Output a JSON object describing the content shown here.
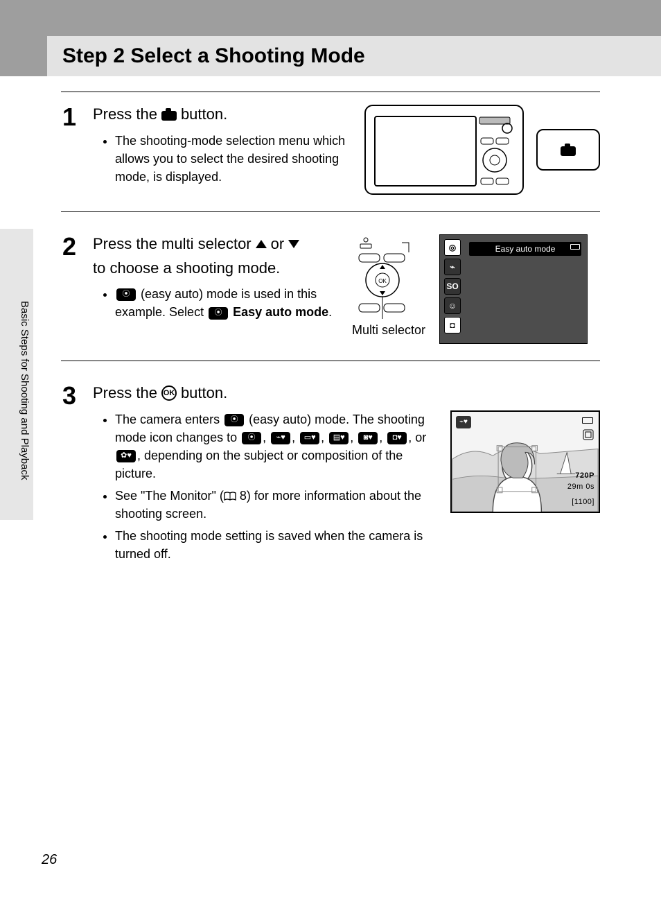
{
  "title": "Step 2 Select a Shooting Mode",
  "side_label": "Basic Steps for Shooting and Playback",
  "page_number": "26",
  "steps": {
    "s1": {
      "num": "1",
      "head_a": "Press the",
      "head_b": "button.",
      "bullet1": "The shooting-mode selection menu which allows you to select the desired shooting mode, is displayed."
    },
    "s2": {
      "num": "2",
      "head_a": "Press the multi selector",
      "head_b": "or",
      "head_c": "to choose a shooting mode.",
      "bullet1_a": "(easy auto) mode is used in this example. Select",
      "bullet1_b": "Easy auto mode",
      "bullet1_c": ".",
      "label_multi": "Multi selector",
      "menu_label": "Easy auto mode",
      "menu_icons": {
        "i1": "◎",
        "i2": "⌁",
        "i3": "SO",
        "i4": "☺",
        "i5": "◘"
      }
    },
    "s3": {
      "num": "3",
      "head_a": "Press the",
      "head_b": "button.",
      "ok_text": "OK",
      "bullet1_a": "The camera enters",
      "bullet1_b": "(easy auto) mode. The shooting mode icon changes to",
      "bullet1_c": ", depending on the subject or composition of the picture.",
      "icon_sep": ", ",
      "icon_or": ", or ",
      "bullet2_a": "See \"The Monitor\" (",
      "bullet2_b": "8) for more information about the shooting screen.",
      "bullet3": "The shooting mode setting is saved when the camera is turned off.",
      "overlay": {
        "res": "720P",
        "time": "29m 0s",
        "count": "[1100]"
      }
    }
  }
}
